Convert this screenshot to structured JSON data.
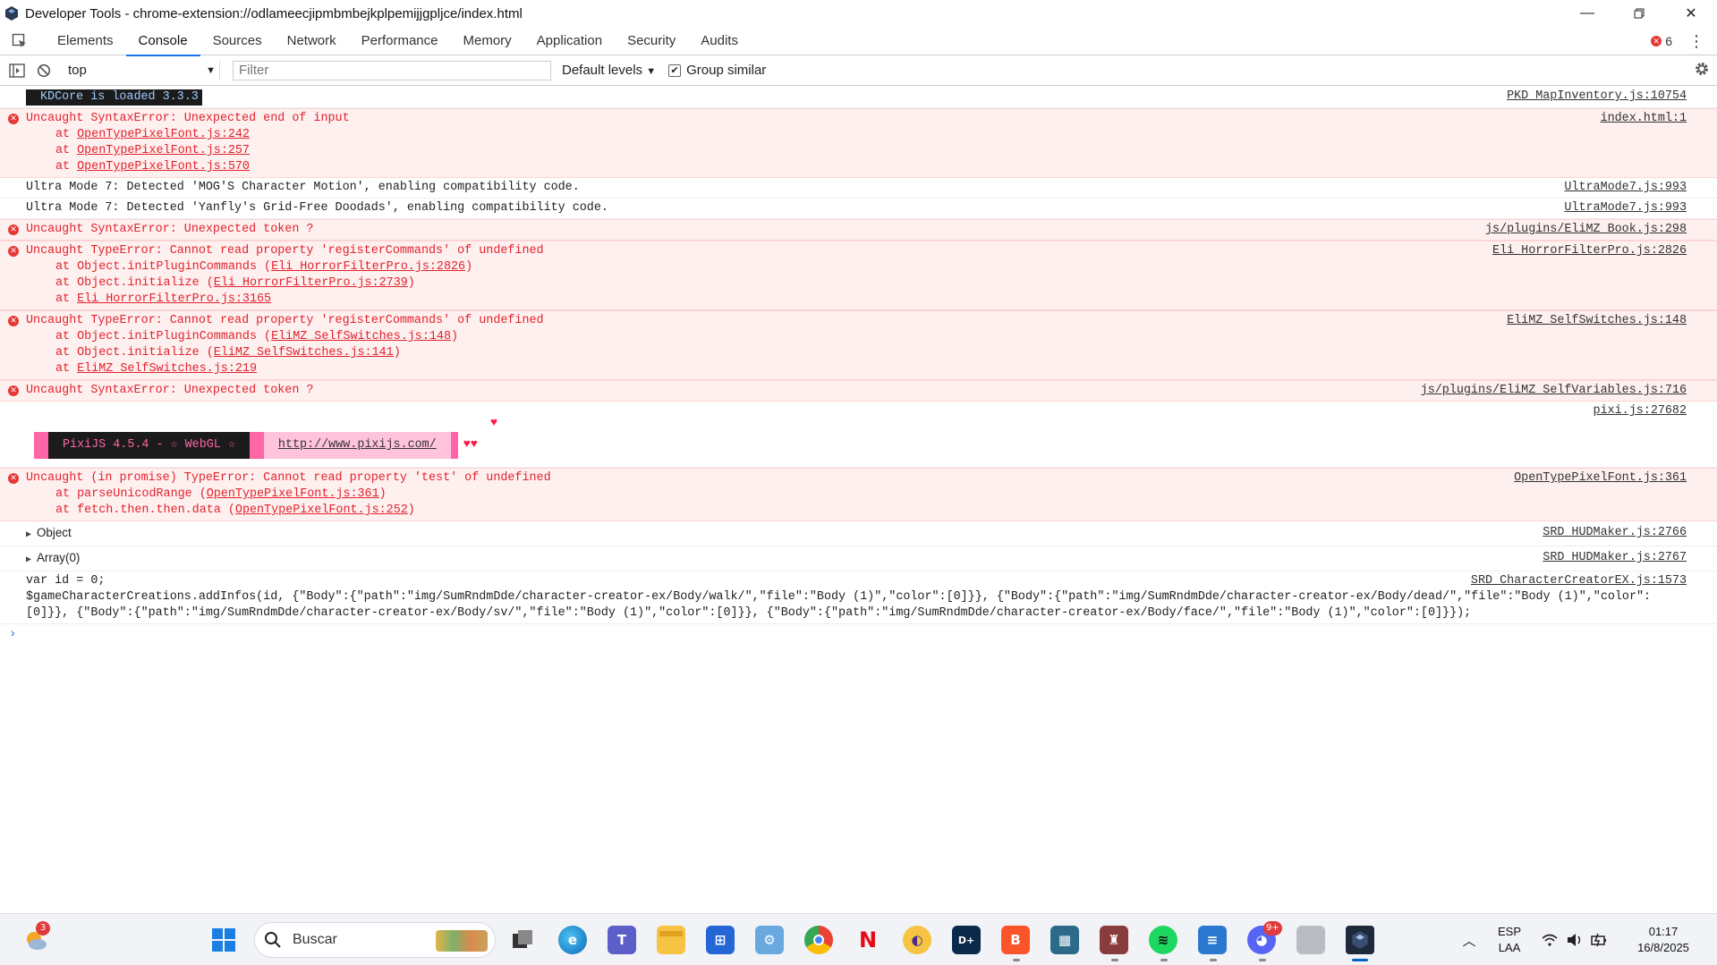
{
  "window": {
    "title": "Developer Tools - chrome-extension://odlameecjipmbmbejkplpemijjgpljce/index.html"
  },
  "tabs": [
    "Elements",
    "Console",
    "Sources",
    "Network",
    "Performance",
    "Memory",
    "Application",
    "Security",
    "Audits"
  ],
  "active_tab": "Console",
  "error_count": "6",
  "toolbar": {
    "context": "top",
    "filter_placeholder": "Filter",
    "levels": "Default levels",
    "group_similar": "Group similar"
  },
  "console": {
    "kdcore": {
      "text": "KDCore is loaded 3.3.3",
      "src": "PKD_MapInventory.js:10754"
    },
    "err1": {
      "msg": "Uncaught SyntaxError: Unexpected end of input",
      "src": "index.html:1",
      "stack": [
        "OpenTypePixelFont.js:242",
        "OpenTypePixelFont.js:257",
        "OpenTypePixelFont.js:570"
      ]
    },
    "log1": {
      "msg": "Ultra Mode 7: Detected 'MOG'S Character Motion', enabling compatibility code.",
      "src": "UltraMode7.js:993"
    },
    "log2": {
      "msg": "Ultra Mode 7: Detected 'Yanfly's Grid-Free Doodads', enabling compatibility code.",
      "src": "UltraMode7.js:993"
    },
    "err2": {
      "msg": "Uncaught SyntaxError: Unexpected token ?",
      "src": "js/plugins/EliMZ_Book.js:298"
    },
    "err3": {
      "msg": "Uncaught TypeError: Cannot read property 'registerCommands' of undefined",
      "src": "Eli_HorrorFilterPro.js:2826",
      "stack": [
        {
          "fn": "Object.initPluginCommands",
          "loc": "Eli_HorrorFilterPro.js:2826"
        },
        {
          "fn": "Object.initialize",
          "loc": "Eli_HorrorFilterPro.js:2739"
        },
        {
          "fn": "",
          "loc": "Eli_HorrorFilterPro.js:3165"
        }
      ]
    },
    "err4": {
      "msg": "Uncaught TypeError: Cannot read property 'registerCommands' of undefined",
      "src": "EliMZ_SelfSwitches.js:148",
      "stack": [
        {
          "fn": "Object.initPluginCommands",
          "loc": "EliMZ_SelfSwitches.js:148"
        },
        {
          "fn": "Object.initialize",
          "loc": "EliMZ_SelfSwitches.js:141"
        },
        {
          "fn": "",
          "loc": "EliMZ_SelfSwitches.js:219"
        }
      ]
    },
    "err5": {
      "msg": "Uncaught SyntaxError: Unexpected token ?",
      "src": "js/plugins/EliMZ_SelfVariables.js:716"
    },
    "pixi": {
      "src": "pixi.js:27682",
      "label": "PixiJS 4.5.4 - ☆ WebGL ☆",
      "url": "http://www.pixijs.com/",
      "hearts": "♥♥",
      "heart": "♥"
    },
    "err6": {
      "msg": "Uncaught (in promise) TypeError: Cannot read property 'test' of undefined",
      "src": "OpenTypePixelFont.js:361",
      "stack": [
        {
          "fn": "parseUnicodRange",
          "loc": "OpenTypePixelFont.js:361"
        },
        {
          "fn": "fetch.then.then.data",
          "loc": "OpenTypePixelFont.js:252"
        }
      ]
    },
    "obj": {
      "label": "Object",
      "src": "SRD_HUDMaker.js:2766"
    },
    "arr": {
      "label": "Array(0)",
      "src": "SRD_HUDMaker.js:2767"
    },
    "code": {
      "src": "SRD_CharacterCreatorEX.js:1573",
      "text": "var id = 0;\n$gameCharacterCreations.addInfos(id, {\"Body\":{\"path\":\"img/SumRndmDde/character-creator-ex/Body/walk/\",\"file\":\"Body (1)\",\"color\":[0]}}, {\"Body\":{\"path\":\"img/SumRndmDde/character-creator-ex/Body/dead/\",\"file\":\"Body (1)\",\"color\":[0]}}, {\"Body\":{\"path\":\"img/SumRndmDde/character-creator-ex/Body/sv/\",\"file\":\"Body (1)\",\"color\":[0]}}, {\"Body\":{\"path\":\"img/SumRndmDde/character-creator-ex/Body/face/\",\"file\":\"Body (1)\",\"color\":[0]}});"
    }
  },
  "taskbar": {
    "search_placeholder": "Buscar",
    "weather_badge": "3",
    "discord_badge": "9+",
    "lang_top": "ESP",
    "lang_bottom": "LAA",
    "time": "01:17",
    "date": "16/8/2025"
  }
}
